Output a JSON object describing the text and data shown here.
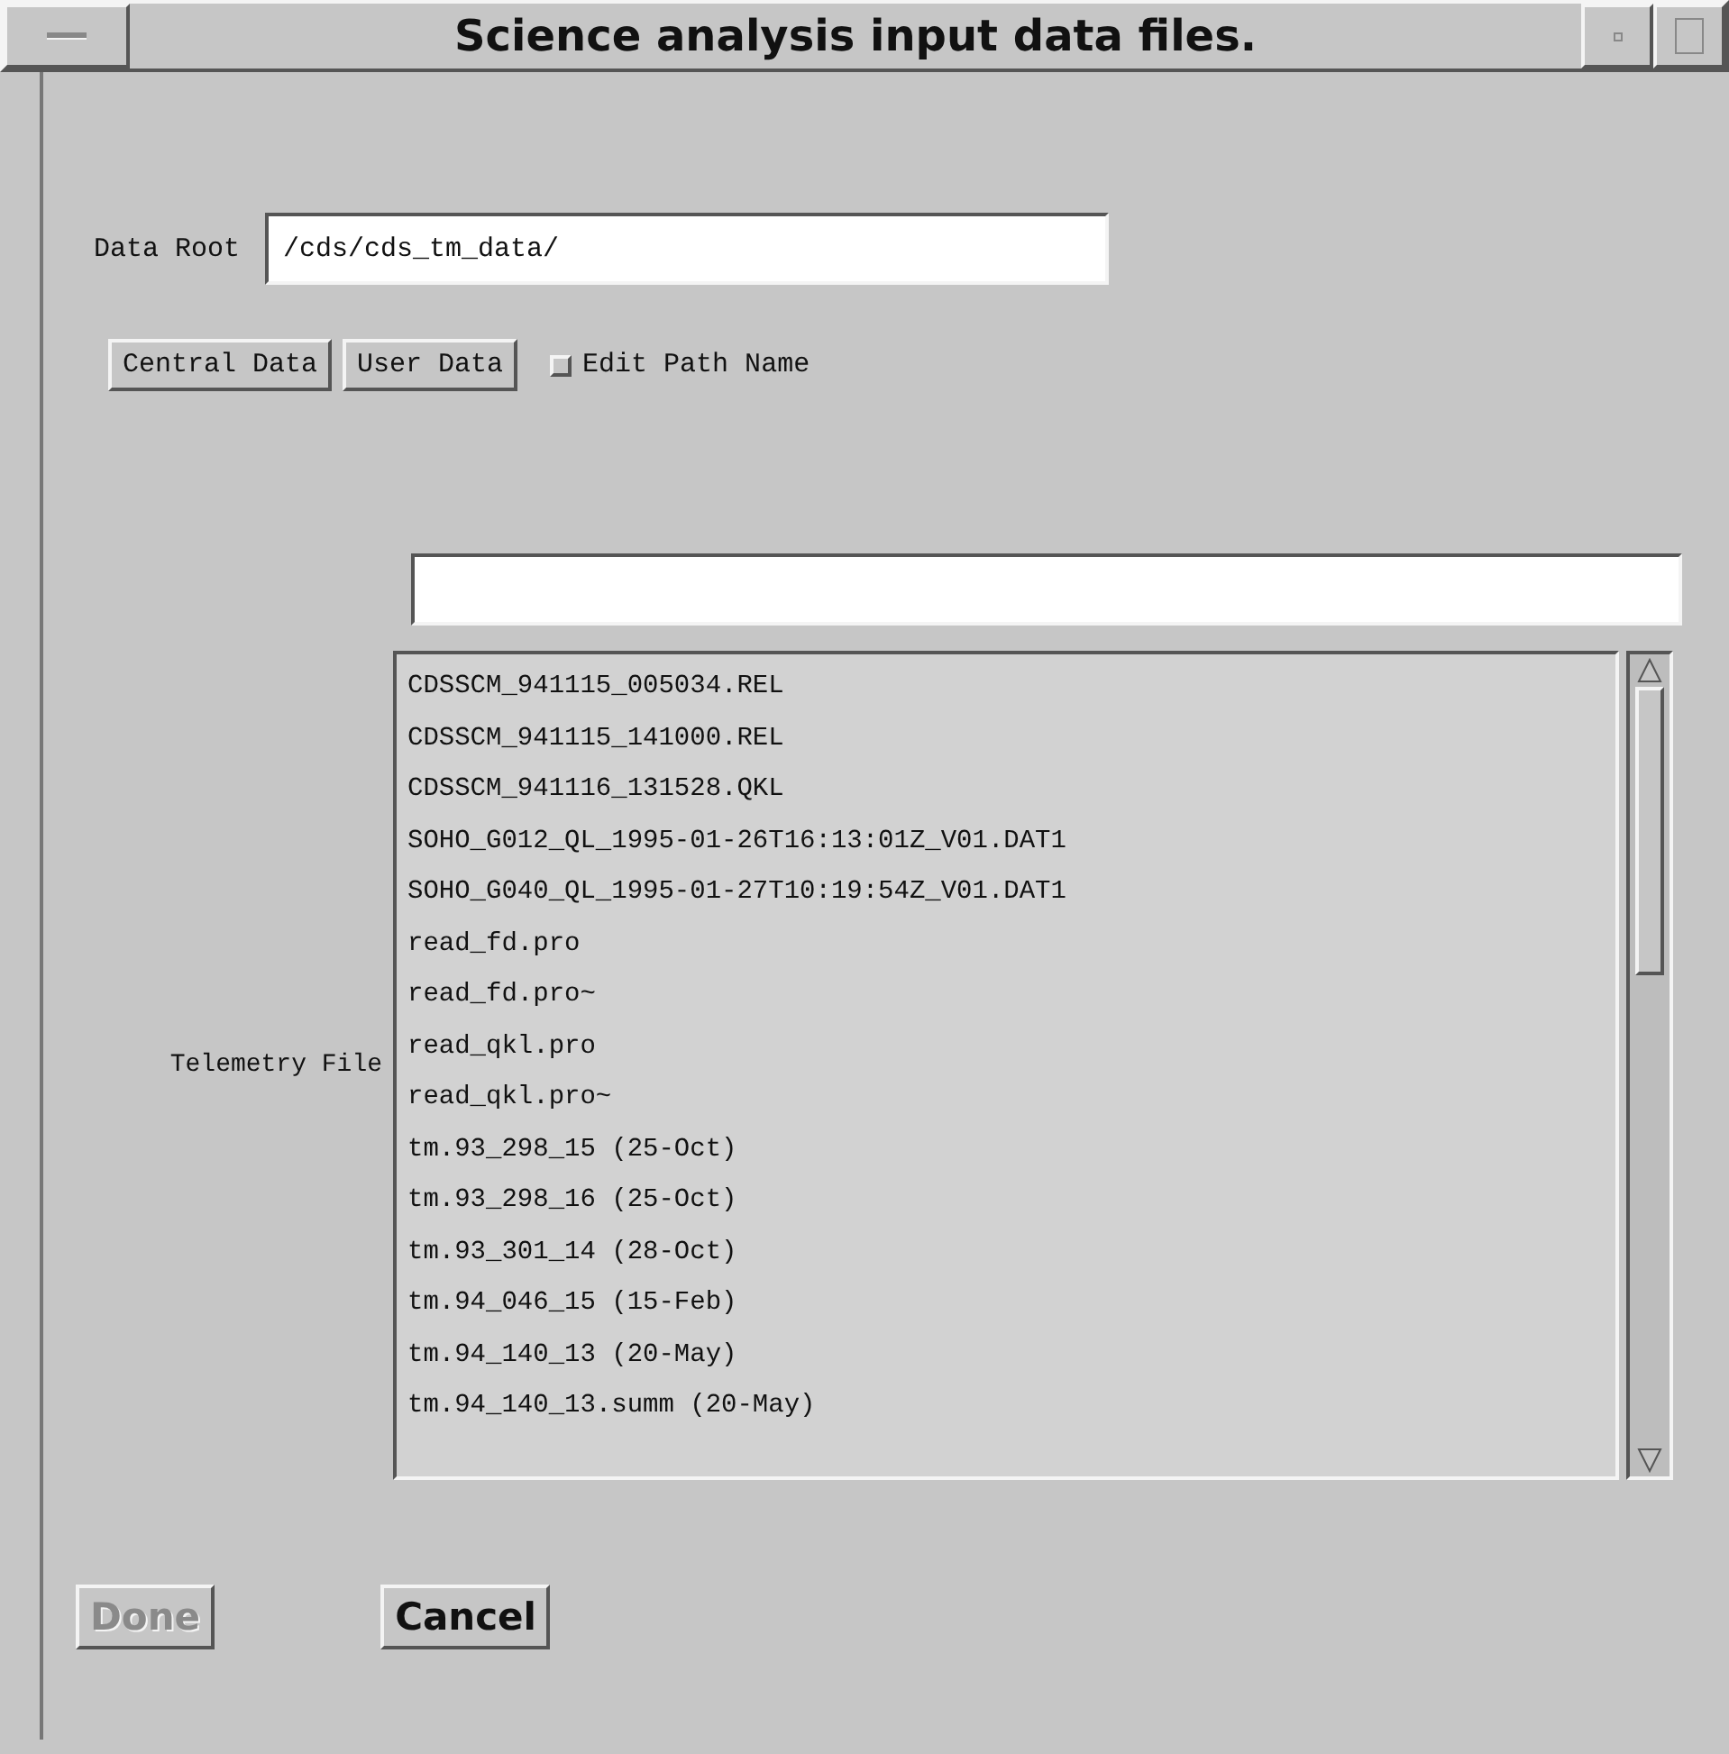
{
  "window": {
    "title": "Science analysis input data files."
  },
  "data_root": {
    "label": "Data Root",
    "value": "/cds/cds_tm_data/"
  },
  "source_buttons": [
    {
      "label": "Central Data"
    },
    {
      "label": "User Data"
    }
  ],
  "edit_path_name": {
    "label": "Edit Path Name",
    "checked": false
  },
  "telemetry_file": {
    "label": "Telemetry File",
    "files": [
      "CDSSCM_941115_005034.REL",
      "CDSSCM_941115_141000.REL",
      "CDSSCM_941116_131528.QKL",
      "SOHO_G012_QL_1995-01-26T16:13:01Z_V01.DAT1",
      "SOHO_G040_QL_1995-01-27T10:19:54Z_V01.DAT1",
      "read_fd.pro",
      "read_fd.pro~",
      "read_qkl.pro",
      "read_qkl.pro~",
      "tm.93_298_15 (25-Oct)",
      "tm.93_298_16 (25-Oct)",
      "tm.93_301_14 (28-Oct)",
      "tm.94_046_15 (15-Feb)",
      "tm.94_140_13 (20-May)",
      "tm.94_140_13.summ (20-May)"
    ]
  },
  "buttons": [
    {
      "label": "Done",
      "disabled": true
    },
    {
      "label": "Cancel",
      "disabled": false
    }
  ]
}
